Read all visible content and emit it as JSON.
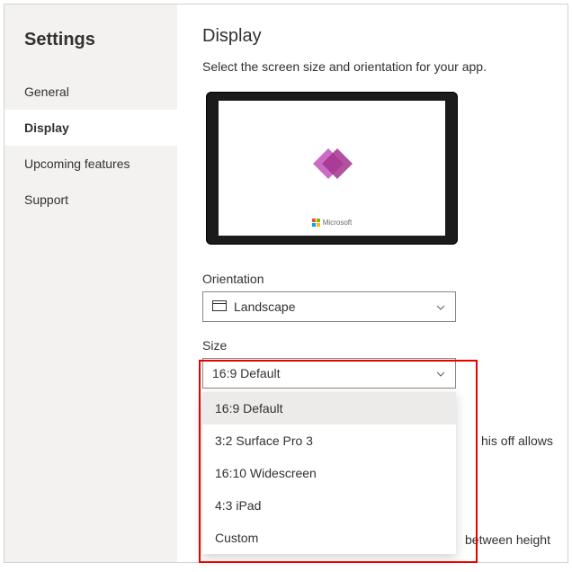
{
  "sidebar": {
    "title": "Settings",
    "items": [
      {
        "label": "General"
      },
      {
        "label": "Display"
      },
      {
        "label": "Upcoming features"
      },
      {
        "label": "Support"
      }
    ],
    "activeIndex": 1
  },
  "main": {
    "title": "Display",
    "subtitle": "Select the screen size and orientation for your app.",
    "preview": {
      "brand": "Microsoft"
    },
    "orientation": {
      "label": "Orientation",
      "value": "Landscape"
    },
    "size": {
      "label": "Size",
      "value": "16:9 Default",
      "options": [
        "16:9 Default",
        "3:2 Surface Pro 3",
        "16:10 Widescreen",
        "4:3 iPad",
        "Custom"
      ]
    },
    "bgFragments": {
      "right1": "his off allows",
      "right2": "between height"
    }
  }
}
